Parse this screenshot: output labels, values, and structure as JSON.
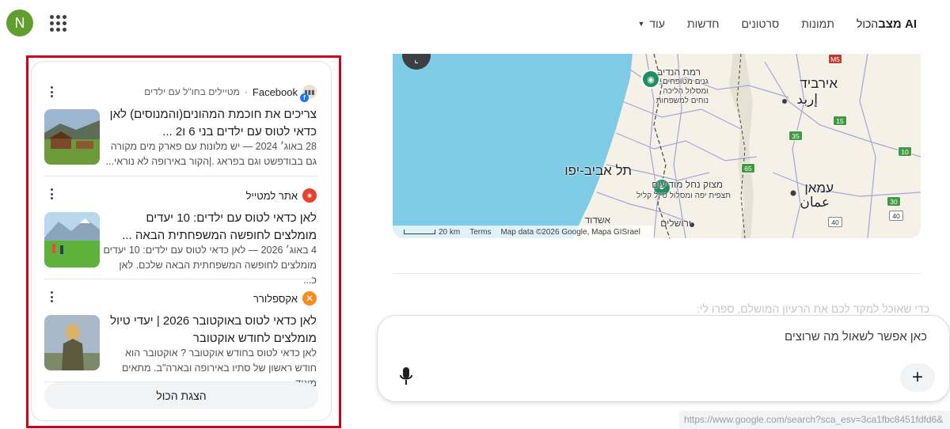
{
  "header": {
    "avatar_letter": "N",
    "tabs": [
      {
        "label": "מצב AI",
        "active": false
      },
      {
        "label": "הכול",
        "active": true
      },
      {
        "label": "תמונות",
        "active": false
      },
      {
        "label": "סרטונים",
        "active": false
      },
      {
        "label": "חדשות",
        "active": false
      }
    ],
    "more_label": "עוד"
  },
  "results": [
    {
      "source_name": "Facebook",
      "source_sub": "מטיילים בחו\"ל עם ילדים",
      "favicon": "facebook-group-icon",
      "title": "צריכים את חוכמת המהונים(והמנוסים) לאן כדאי לטוס עם ילדים בני 6 ו2 ...",
      "snippet": "28 באוג׳ 2024 — יש מלונות עם פארק מים מקורה גם בבודפשט וגם בפראג .|הקור באירופה לא נוראי..."
    },
    {
      "source_name": "אתר למטייל",
      "favicon": "etr-lametayel-icon",
      "title": "לאן כדאי לטוס עם ילדים: 10 יעדים מומלצים לחופשה המשפחתית הבאה ...",
      "snippet": "4 באוג׳ 2026 — לאן כדאי לטוס עם ילדים: 10 יעדים מומלצים לחופשה המשפחתית הבאה שלכם. לאן כ..."
    },
    {
      "source_name": "אקספלורר",
      "favicon": "explorer-icon",
      "title": "לאן כדאי לטוס באוקטובר 2026 | יעדי טיול מומלצים לחודש אוקטובר",
      "snippet": "לאן כדאי לטוס בחודש אוקטובר ? אוקטובר הוא חודש ראשון של סתיו באירופה ובארה\"ב. מתאים מאוד..."
    }
  ],
  "show_all_label": "הצגת הכול",
  "map": {
    "labels": {
      "ramat_hanadiv": "רמת הנדיב",
      "park_text": "גנים מטופחים ומסלול הליכה נוחים למשפחות",
      "irbid": "אירביד",
      "irbid_ar": "إربد",
      "tel_aviv": "תל אביב-יפו",
      "nahal_taninim": "מצוק נחל מודיעים",
      "nahal_taninim_sub": "תצפית יפה ומסלול טיול קליל",
      "amman": "עמאן",
      "amman_ar": "عمان",
      "ashdod": "אשדוד",
      "jerusalem": "ירושלים"
    },
    "shields": [
      "M5",
      "15",
      "35",
      "65",
      "10",
      "30",
      "40",
      "40"
    ],
    "scale": "20 km",
    "terms": "Terms",
    "attribution": "Map data ©2026 Google, Mapa GISrael"
  },
  "faded_prompt": "כדי שאוכל למקד לכם את הרעיון המושלם, ספרו לי:",
  "ask": {
    "placeholder": "כאן אפשר לשאול מה שרוצים"
  },
  "status_url": "https://www.google.com/search?sca_esv=3ca1fbc8451fdfd6&"
}
